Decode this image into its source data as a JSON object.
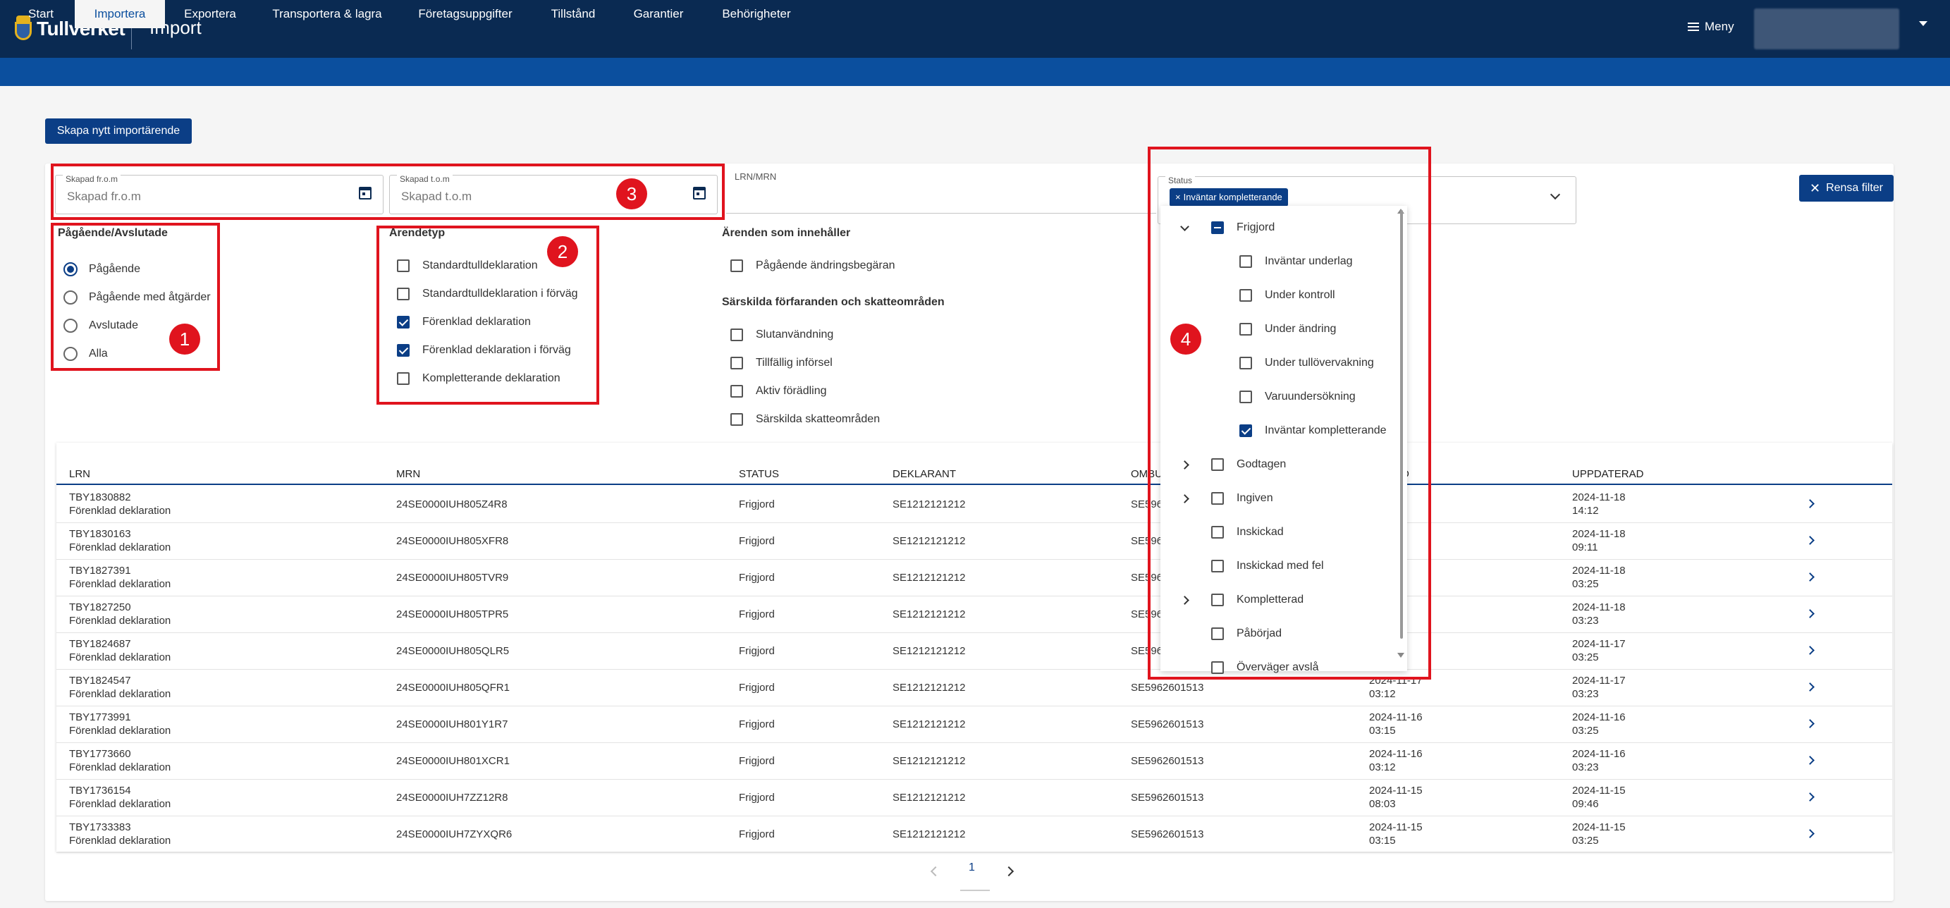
{
  "header": {
    "logo_text": "Tullverket",
    "app_title": "Import",
    "menu_label": "Meny"
  },
  "nav": {
    "tabs": [
      "Start",
      "Importera",
      "Exportera",
      "Transportera & lagra",
      "Företagsuppgifter",
      "Tillstånd",
      "Garantier",
      "Behörigheter"
    ],
    "active": "Importera"
  },
  "actions": {
    "create_label": "Skapa nytt importärende",
    "clear_filter_label": "Rensa filter"
  },
  "filters": {
    "created_from": {
      "label": "Skapad fr.o.m",
      "placeholder": "Skapad fr.o.m"
    },
    "created_to": {
      "label": "Skapad t.o.m",
      "placeholder": "Skapad t.o.m"
    },
    "lrn_mrn_label": "LRN/MRN",
    "status_label": "Status",
    "status_chip": "Inväntar kompletterande",
    "progress": {
      "title": "Pågående/Avslutade",
      "options": [
        "Pågående",
        "Pågående med åtgärder",
        "Avslutade",
        "Alla"
      ],
      "selected": "Pågående"
    },
    "case_type": {
      "title": "Ärendetyp",
      "options": [
        {
          "label": "Standardtulldeklaration",
          "checked": false
        },
        {
          "label": "Standardtulldeklaration i förväg",
          "checked": false
        },
        {
          "label": "Förenklad deklaration",
          "checked": true
        },
        {
          "label": "Förenklad deklaration i förväg",
          "checked": true
        },
        {
          "label": "Kompletterande deklaration",
          "checked": false
        }
      ]
    },
    "contains": {
      "title": "Ärenden som innehåller",
      "options": [
        {
          "label": "Pågående ändringsbegäran",
          "checked": false
        }
      ]
    },
    "special": {
      "title": "Särskilda förfaranden och skatteområden",
      "options": [
        {
          "label": "Slutanvändning",
          "checked": false
        },
        {
          "label": "Tillfällig införsel",
          "checked": false
        },
        {
          "label": "Aktiv förädling",
          "checked": false
        },
        {
          "label": "Särskilda skatteområden",
          "checked": false
        }
      ]
    }
  },
  "status_dropdown": [
    {
      "label": "Frigjord",
      "level": 0,
      "state": "indeterminate",
      "expander": "down"
    },
    {
      "label": "Inväntar underlag",
      "level": 1,
      "state": "off"
    },
    {
      "label": "Under kontroll",
      "level": 1,
      "state": "off"
    },
    {
      "label": "Under ändring",
      "level": 1,
      "state": "off"
    },
    {
      "label": "Under tullövervakning",
      "level": 1,
      "state": "off"
    },
    {
      "label": "Varuundersökning",
      "level": 1,
      "state": "off"
    },
    {
      "label": "Inväntar kompletterande",
      "level": 1,
      "state": "on"
    },
    {
      "label": "Godtagen",
      "level": 0,
      "state": "off",
      "expander": "right"
    },
    {
      "label": "Ingiven",
      "level": 0,
      "state": "off",
      "expander": "right"
    },
    {
      "label": "Inskickad",
      "level": 0,
      "state": "off"
    },
    {
      "label": "Inskickad med fel",
      "level": 0,
      "state": "off"
    },
    {
      "label": "Kompletterad",
      "level": 0,
      "state": "off",
      "expander": "right"
    },
    {
      "label": "Påbörjad",
      "level": 0,
      "state": "off"
    },
    {
      "label": "Överväger avslå",
      "level": 0,
      "state": "off"
    }
  ],
  "table": {
    "columns": [
      "LRN",
      "MRN",
      "STATUS",
      "DEKLARANT",
      "OMBUD",
      "D",
      "UPPDATERAD"
    ],
    "rows": [
      {
        "lrn": "TBY1830882",
        "type": "Förenklad deklaration",
        "mrn": "24SE0000IUH805Z4R8",
        "status": "Frigjord",
        "deklarant": "SE1212121212",
        "ombud": "SE5962",
        "created_date": "I-18",
        "created_time": "",
        "updated_date": "2024-11-18",
        "updated_time": "14:12"
      },
      {
        "lrn": "TBY1830163",
        "type": "Förenklad deklaration",
        "mrn": "24SE0000IUH805XFR8",
        "status": "Frigjord",
        "deklarant": "SE1212121212",
        "ombud": "SE5962",
        "created_date": "I-18",
        "created_time": "",
        "updated_date": "2024-11-18",
        "updated_time": "09:11"
      },
      {
        "lrn": "TBY1827391",
        "type": "Förenklad deklaration",
        "mrn": "24SE0000IUH805TVR9",
        "status": "Frigjord",
        "deklarant": "SE1212121212",
        "ombud": "SE5962",
        "created_date": "I-18",
        "created_time": "",
        "updated_date": "2024-11-18",
        "updated_time": "03:25"
      },
      {
        "lrn": "TBY1827250",
        "type": "Förenklad deklaration",
        "mrn": "24SE0000IUH805TPR5",
        "status": "Frigjord",
        "deklarant": "SE1212121212",
        "ombud": "SE5962",
        "created_date": "I-18",
        "created_time": "",
        "updated_date": "2024-11-18",
        "updated_time": "03:23"
      },
      {
        "lrn": "TBY1824687",
        "type": "Förenklad deklaration",
        "mrn": "24SE0000IUH805QLR5",
        "status": "Frigjord",
        "deklarant": "SE1212121212",
        "ombud": "SE5962",
        "created_date": "I-17",
        "created_time": "",
        "updated_date": "2024-11-17",
        "updated_time": "03:25"
      },
      {
        "lrn": "TBY1824547",
        "type": "Förenklad deklaration",
        "mrn": "24SE0000IUH805QFR1",
        "status": "Frigjord",
        "deklarant": "SE1212121212",
        "ombud": "SE5962601513",
        "created_date": "2024-11-17",
        "created_time": "03:12",
        "updated_date": "2024-11-17",
        "updated_time": "03:23"
      },
      {
        "lrn": "TBY1773991",
        "type": "Förenklad deklaration",
        "mrn": "24SE0000IUH801Y1R7",
        "status": "Frigjord",
        "deklarant": "SE1212121212",
        "ombud": "SE5962601513",
        "created_date": "2024-11-16",
        "created_time": "03:15",
        "updated_date": "2024-11-16",
        "updated_time": "03:25"
      },
      {
        "lrn": "TBY1773660",
        "type": "Förenklad deklaration",
        "mrn": "24SE0000IUH801XCR1",
        "status": "Frigjord",
        "deklarant": "SE1212121212",
        "ombud": "SE5962601513",
        "created_date": "2024-11-16",
        "created_time": "03:12",
        "updated_date": "2024-11-16",
        "updated_time": "03:23"
      },
      {
        "lrn": "TBY1736154",
        "type": "Förenklad deklaration",
        "mrn": "24SE0000IUH7ZZ12R8",
        "status": "Frigjord",
        "deklarant": "SE1212121212",
        "ombud": "SE5962601513",
        "created_date": "2024-11-15",
        "created_time": "08:03",
        "updated_date": "2024-11-15",
        "updated_time": "09:46"
      },
      {
        "lrn": "TBY1733383",
        "type": "Förenklad deklaration",
        "mrn": "24SE0000IUH7ZYXQR6",
        "status": "Frigjord",
        "deklarant": "SE1212121212",
        "ombud": "SE5962601513",
        "created_date": "2024-11-15",
        "created_time": "03:15",
        "updated_date": "2024-11-15",
        "updated_time": "03:25"
      }
    ]
  },
  "pagination": {
    "current": "1"
  },
  "annotations": [
    "1",
    "2",
    "3",
    "4"
  ],
  "colors": {
    "header": "#0a2a52",
    "nav": "#0b4f9e",
    "primary": "#0b3e86",
    "highlight": "#e0141e"
  }
}
